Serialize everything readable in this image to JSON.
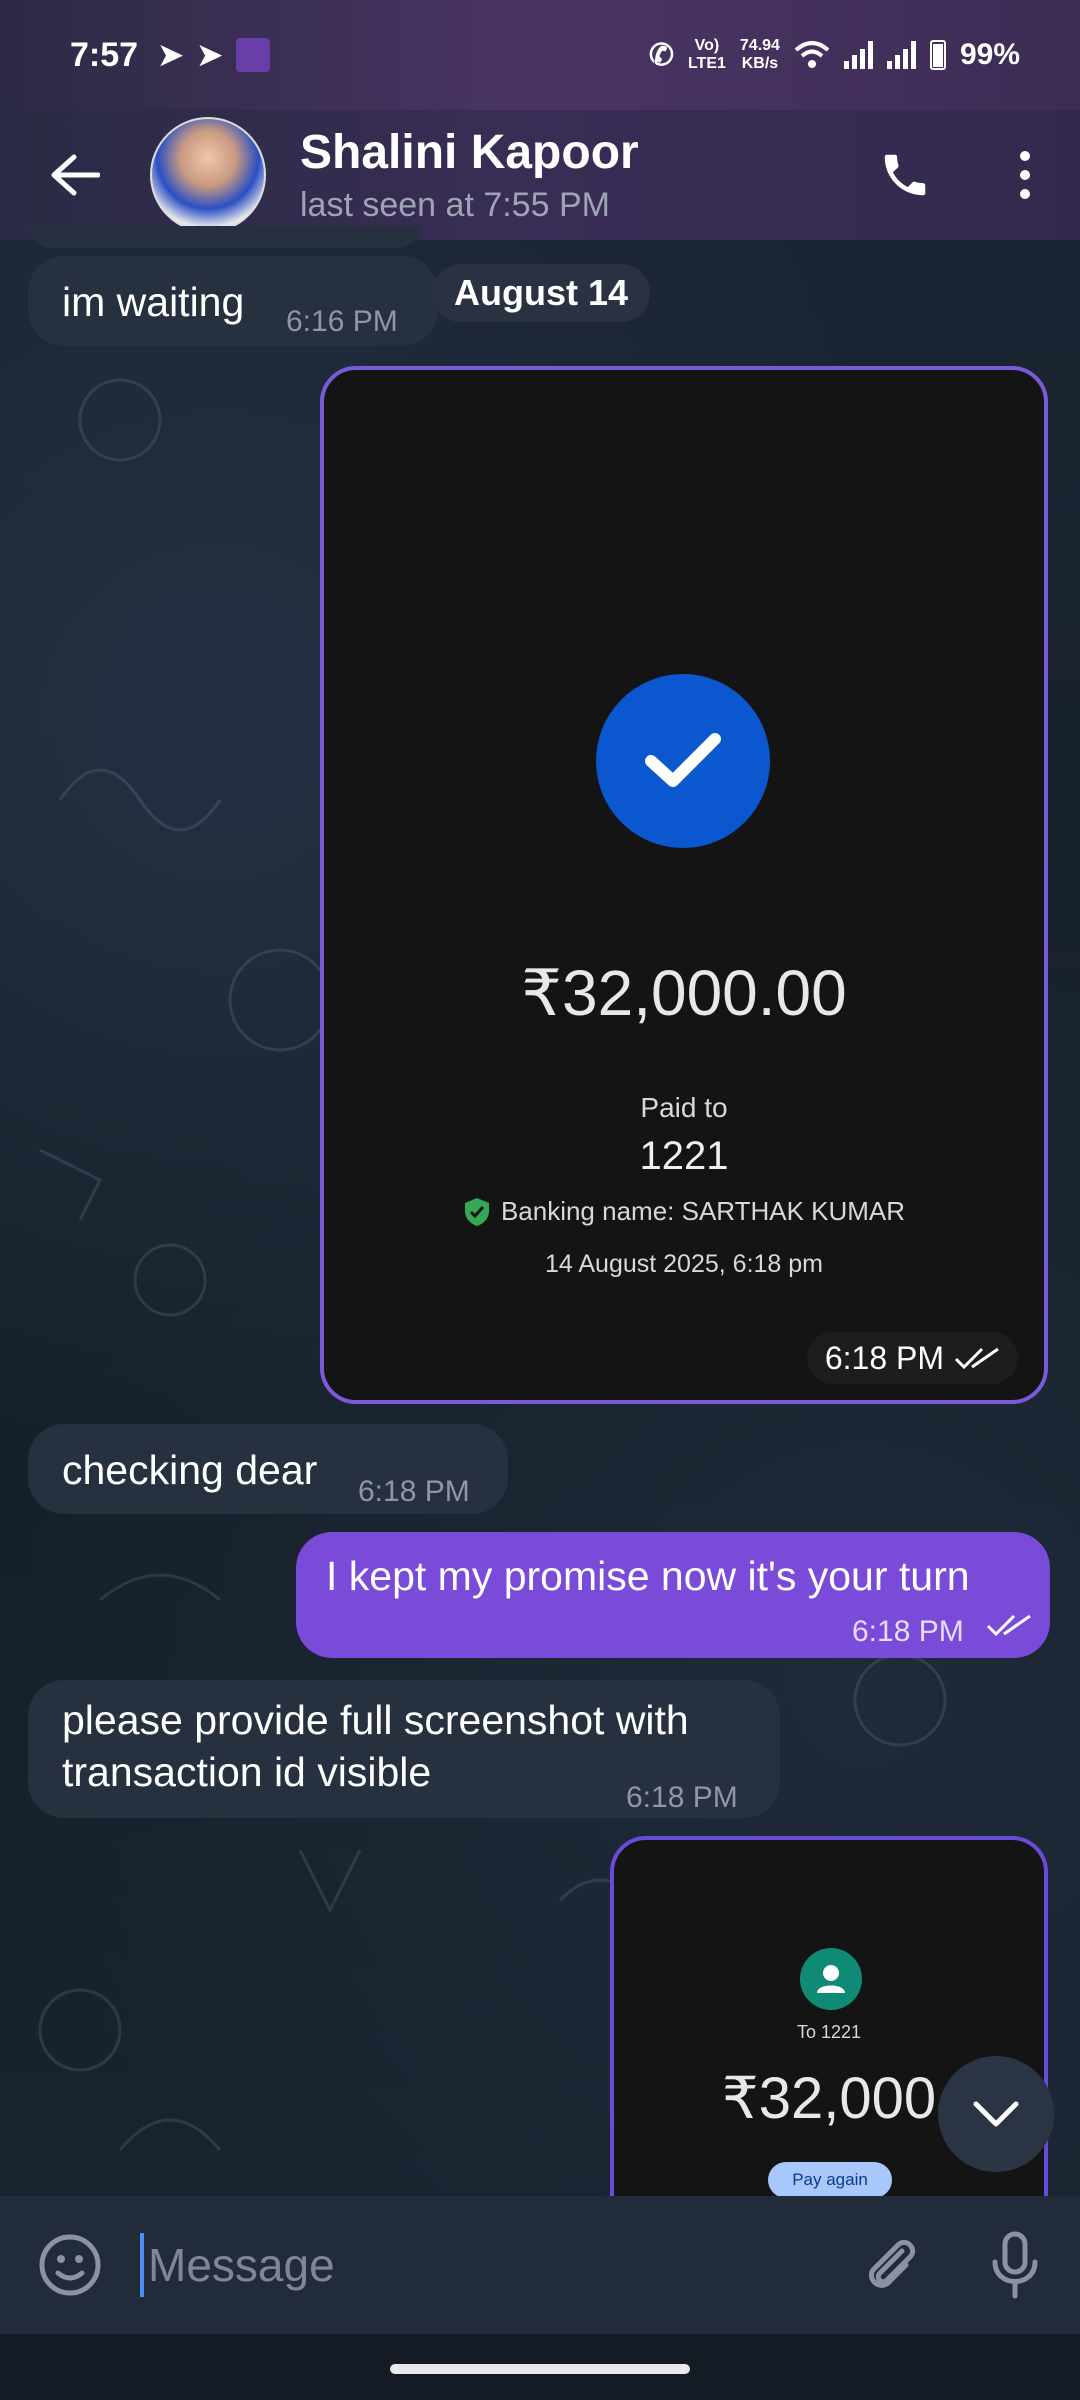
{
  "status_bar": {
    "time": "7:57",
    "speed_value": "74.94",
    "speed_unit": "KB/s",
    "volte": "Vo)",
    "lte": "LTE1",
    "battery": "99%"
  },
  "header": {
    "contact_name": "Shalini Kapoor",
    "last_seen": "last seen at 7:55 PM"
  },
  "messages": {
    "m1_text": "im waiting",
    "m1_time": "6:16 PM",
    "date_chip": "August 14",
    "payment1": {
      "amount": "₹32,000.00",
      "paid_to_label": "Paid to",
      "payee": "1221",
      "banking_name": "Banking name: SARTHAK  KUMAR",
      "datetime": "14 August 2025, 6:18 pm",
      "time": "6:18 PM"
    },
    "m2_text": "checking dear",
    "m2_time": "6:18 PM",
    "m3_text": "I kept my promise now it's your turn",
    "m3_time": "6:18 PM",
    "m4_line1": "please provide full screenshot with",
    "m4_line2": "transaction id visible",
    "m4_time": "6:18 PM",
    "payment2": {
      "to_label": "To 1221",
      "amount": "₹32,000",
      "pay_again": "Pay again"
    }
  },
  "composer": {
    "placeholder": "Message"
  },
  "colors": {
    "accent": "#7a4ad8",
    "gpay_blue": "#0b57d0"
  }
}
